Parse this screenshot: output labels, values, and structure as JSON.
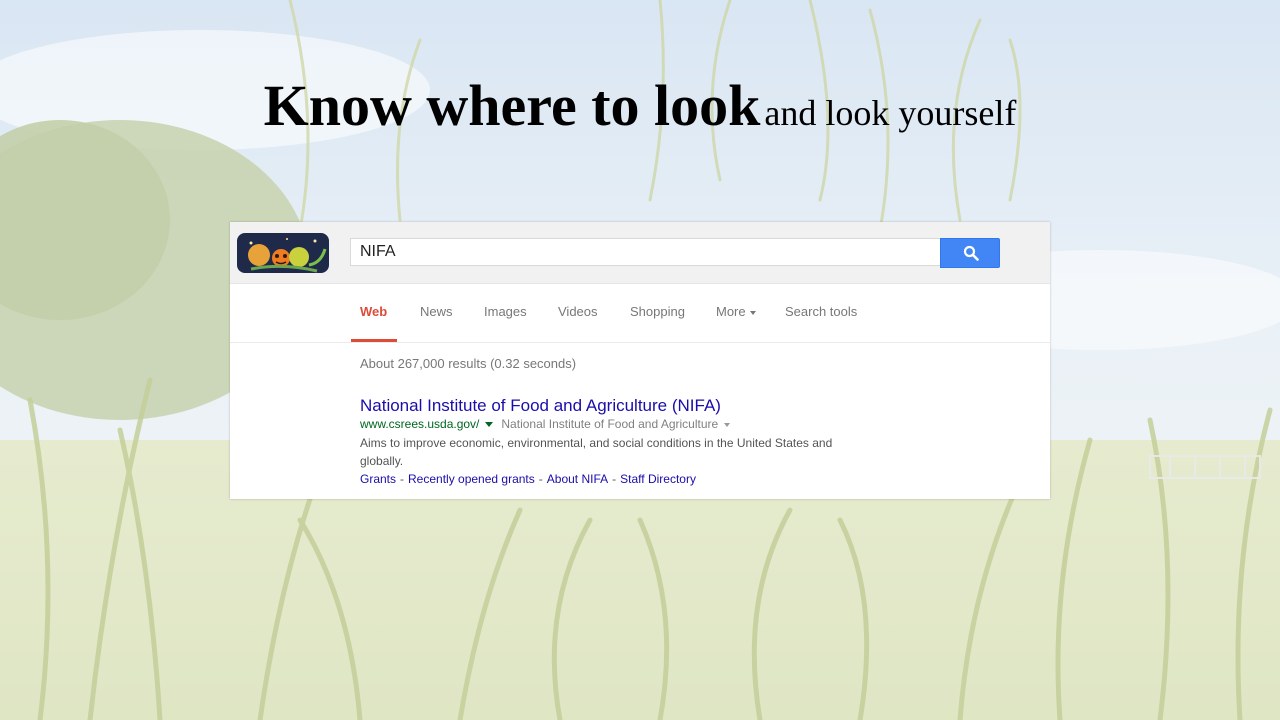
{
  "slide": {
    "title_bold": "Know where to look",
    "title_rest": "and look yourself"
  },
  "search": {
    "query": "NIFA",
    "button_icon": "search-icon",
    "logo_icon": "google-halloween-doodle-icon"
  },
  "tabs": [
    {
      "label": "Web",
      "active": true
    },
    {
      "label": "News"
    },
    {
      "label": "Images"
    },
    {
      "label": "Videos"
    },
    {
      "label": "Shopping"
    },
    {
      "label": "More"
    },
    {
      "label": "Search tools"
    }
  ],
  "results": {
    "stats": "About 267,000 results (0.32 seconds)",
    "items": [
      {
        "title": "National Institute of Food and Agriculture (NIFA)",
        "url": "www.csrees.usda.gov/",
        "breadcrumb": "National Institute of Food and Agriculture",
        "snippet": "Aims to improve economic, environmental, and social conditions in the United States and globally.",
        "sitelinks": [
          "Grants",
          "Recently opened grants",
          "About NIFA",
          "Staff Directory"
        ]
      }
    ]
  },
  "colors": {
    "accent_red": "#dd4b39",
    "link_blue": "#1a0dab",
    "url_green": "#006621",
    "button_blue": "#4285f4"
  }
}
